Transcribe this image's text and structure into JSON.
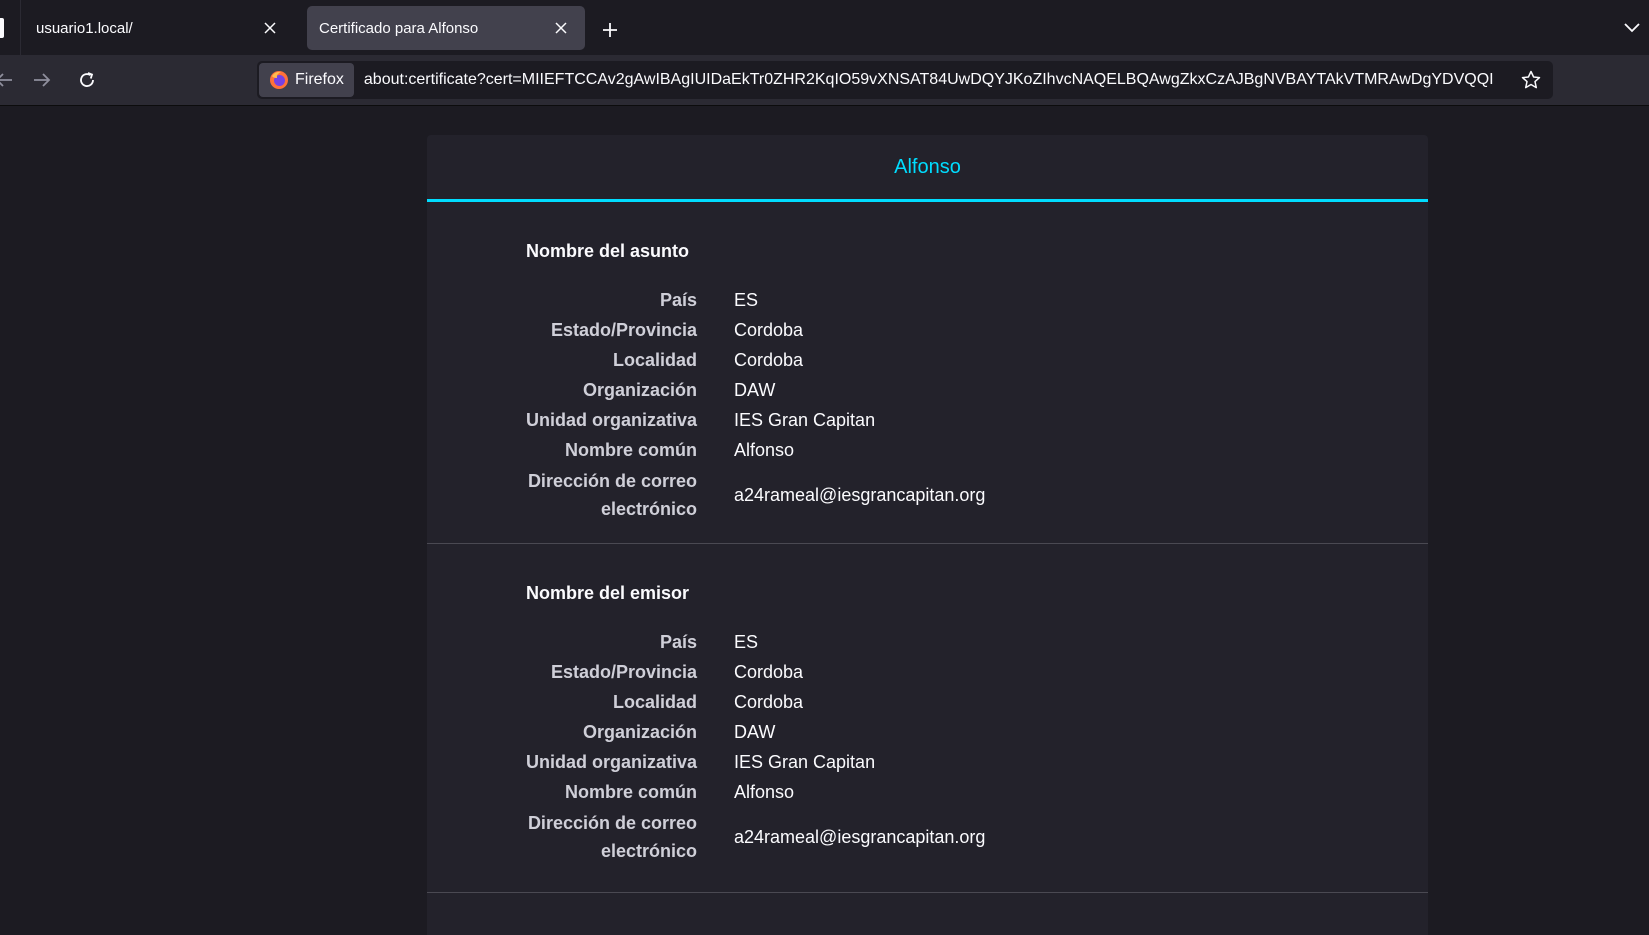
{
  "tabs": [
    {
      "title": "usuario1.local/"
    },
    {
      "title": "Certificado para Alfonso"
    }
  ],
  "navbar": {
    "identity_label": "Firefox",
    "url": "about:certificate?cert=MIIEFTCCAv2gAwIBAgIUIDaEkTr0ZHR2KqIO59vXNSAT84UwDQYJKoZIhvcNAQELBQAwgZkxCzAJBgNVBAYTAkVTMRAwDgYDVQQI"
  },
  "certificate": {
    "tab_title": "Alfonso",
    "subject": {
      "title": "Nombre del asunto",
      "rows": [
        {
          "label": "País",
          "value": "ES"
        },
        {
          "label": "Estado/Provincia",
          "value": "Cordoba"
        },
        {
          "label": "Localidad",
          "value": "Cordoba"
        },
        {
          "label": "Organización",
          "value": "DAW"
        },
        {
          "label": "Unidad organizativa",
          "value": "IES Gran Capitan"
        },
        {
          "label": "Nombre común",
          "value": "Alfonso"
        },
        {
          "label": "Dirección de correo electrónico",
          "value": "a24rameal@iesgrancapitan.org"
        }
      ]
    },
    "issuer": {
      "title": "Nombre del emisor",
      "rows": [
        {
          "label": "País",
          "value": "ES"
        },
        {
          "label": "Estado/Provincia",
          "value": "Cordoba"
        },
        {
          "label": "Localidad",
          "value": "Cordoba"
        },
        {
          "label": "Organización",
          "value": "DAW"
        },
        {
          "label": "Unidad organizativa",
          "value": "IES Gran Capitan"
        },
        {
          "label": "Nombre común",
          "value": "Alfonso"
        },
        {
          "label": "Dirección de correo electrónico",
          "value": "a24rameal@iesgrancapitan.org"
        }
      ]
    }
  }
}
